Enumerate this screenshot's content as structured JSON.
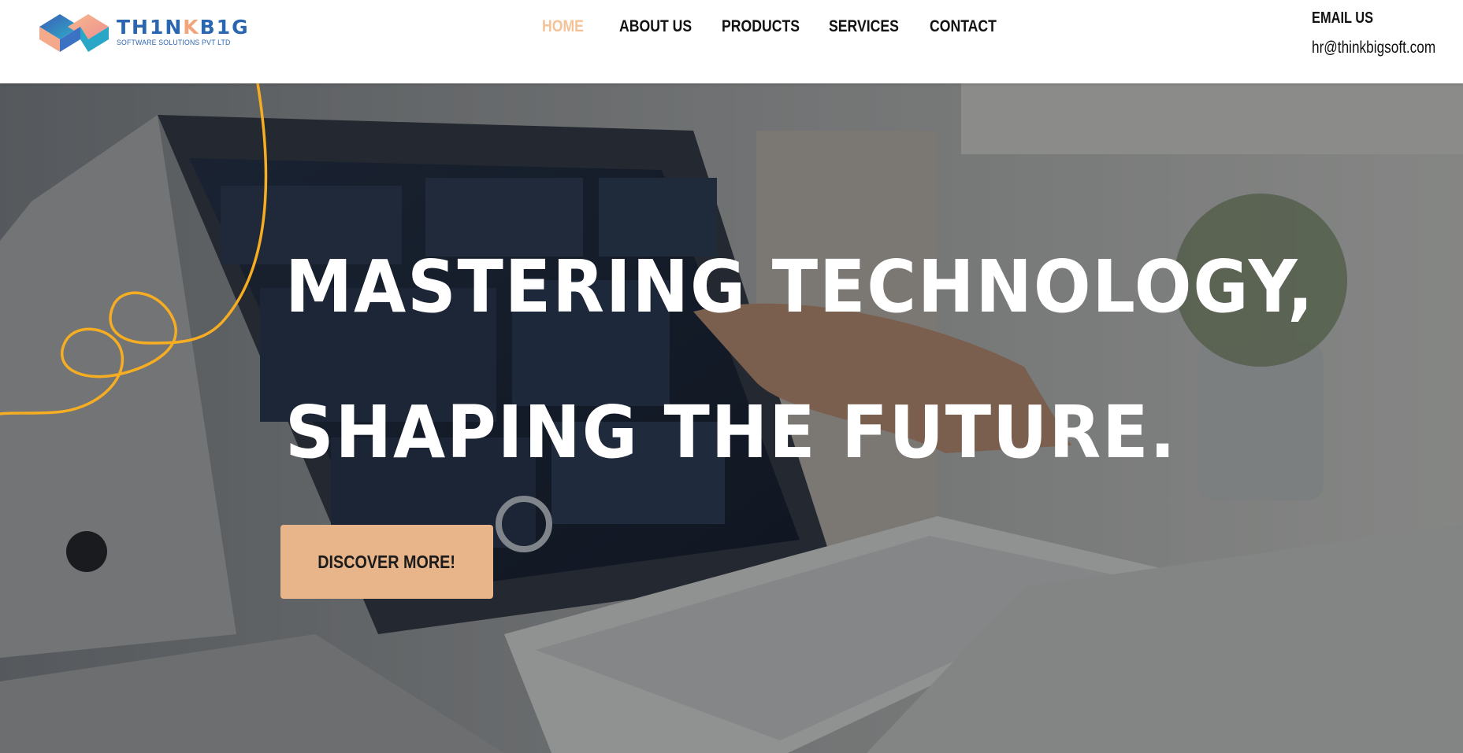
{
  "header": {
    "logo": {
      "brand_prefix": "TH1N",
      "brand_k": "K",
      "brand_suffix": "B1G",
      "tagline": "SOFTWARE SOLUTIONS PVT LTD"
    },
    "nav": [
      {
        "label": "HOME",
        "active": true
      },
      {
        "label": "ABOUT US",
        "active": false
      },
      {
        "label": "PRODUCTS",
        "active": false
      },
      {
        "label": "SERVICES",
        "active": false
      },
      {
        "label": "CONTACT",
        "active": false
      }
    ],
    "contact": {
      "label": "EMAIL US",
      "email": "hr@thinkbigsoft.com"
    }
  },
  "hero": {
    "headline_line1": "MASTERING TECHNOLOGY,",
    "headline_line2": "SHAPING THE FUTURE.",
    "cta_label": "DISCOVER MORE!",
    "background": "laptop-dashboard-photo",
    "decoration": "yellow-squiggle-line"
  },
  "colors": {
    "nav_active": "#f5c397",
    "cta_background": "#e8b48a",
    "squiggle": "#f6ad22",
    "brand_blue": "#2b66b0",
    "brand_peach": "#f2a57a"
  }
}
